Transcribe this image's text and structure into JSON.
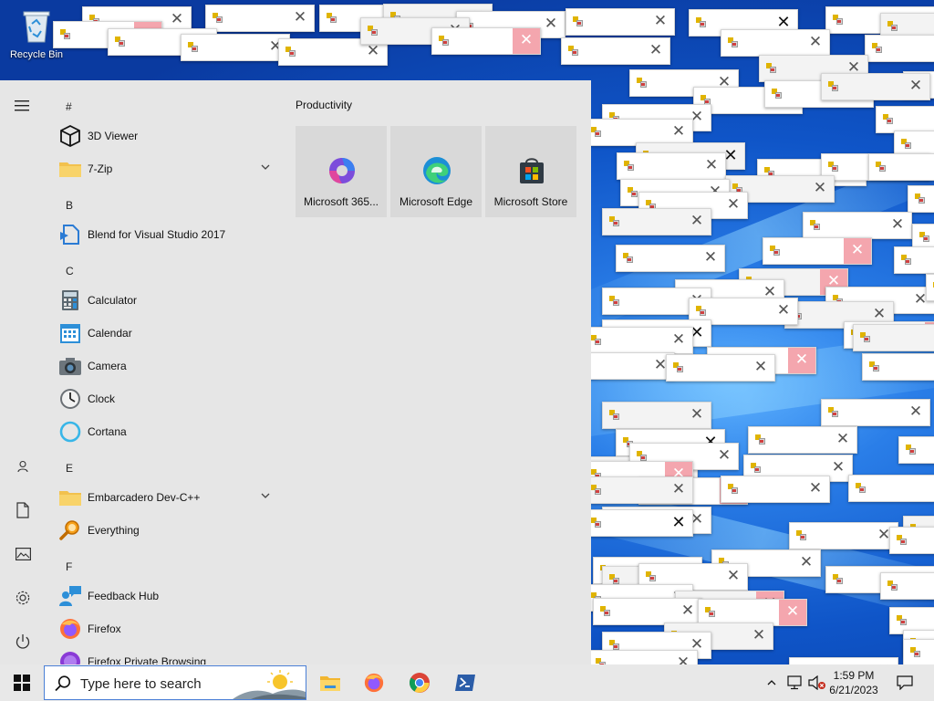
{
  "desktop": {
    "recycle_bin_label": "Recycle Bin"
  },
  "start_menu": {
    "sections": [
      {
        "letter": "#"
      },
      {
        "letter": "B"
      },
      {
        "letter": "C"
      },
      {
        "letter": "E"
      },
      {
        "letter": "F"
      }
    ],
    "apps": [
      {
        "label": "3D Viewer",
        "icon": "3d-viewer-icon"
      },
      {
        "label": "7-Zip",
        "icon": "folder-icon",
        "expandable": true
      },
      {
        "label": "Blend for Visual Studio 2017",
        "icon": "blend-icon"
      },
      {
        "label": "Calculator",
        "icon": "calculator-icon"
      },
      {
        "label": "Calendar",
        "icon": "calendar-icon"
      },
      {
        "label": "Camera",
        "icon": "camera-icon"
      },
      {
        "label": "Clock",
        "icon": "clock-icon"
      },
      {
        "label": "Cortana",
        "icon": "cortana-icon"
      },
      {
        "label": "Embarcadero Dev-C++",
        "icon": "folder-icon",
        "expandable": true
      },
      {
        "label": "Everything",
        "icon": "everything-icon"
      },
      {
        "label": "Feedback Hub",
        "icon": "feedback-hub-icon"
      },
      {
        "label": "Firefox",
        "icon": "firefox-icon"
      },
      {
        "label": "Firefox Private Browsing",
        "icon": "firefox-private-icon"
      }
    ],
    "tile_group": {
      "title": "Productivity",
      "tiles": [
        {
          "label": "Microsoft 365...",
          "icon": "microsoft-365-icon"
        },
        {
          "label": "Microsoft Edge",
          "icon": "edge-icon"
        },
        {
          "label": "Microsoft Store",
          "icon": "store-icon"
        }
      ]
    }
  },
  "taskbar": {
    "search_placeholder": "Type here to search",
    "pinned": [
      "file-explorer-icon",
      "firefox-icon",
      "chrome-icon",
      "powershell-icon"
    ],
    "clock_time": "1:59 PM",
    "clock_date": "6/21/2023"
  },
  "colors": {
    "desktop_blue": "#0f55c8",
    "start_bg": "#e6e6e6",
    "taskbar_bg": "#e8e8e8",
    "close_hover": "#f4a6ae"
  }
}
